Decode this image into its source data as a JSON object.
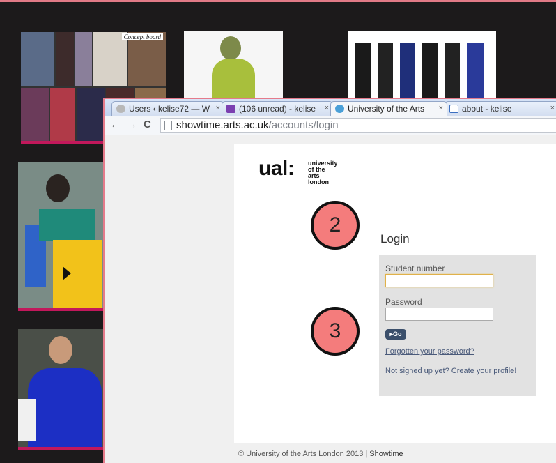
{
  "gallery": {
    "concept_label": "Concept board"
  },
  "browser": {
    "tabs": [
      {
        "label": "Users ‹ kelise72 — W",
        "icon": "wordpress-icon",
        "active": false
      },
      {
        "label": "(106 unread) - kelise",
        "icon": "mail-icon",
        "active": false
      },
      {
        "label": "University of the Arts",
        "icon": "globe-icon",
        "active": true
      },
      {
        "label": "about - kelise",
        "icon": "page-icon",
        "active": false
      }
    ],
    "tab_close": "×",
    "url_host": "showtime.arts.ac.uk",
    "url_path": "/accounts/login"
  },
  "page": {
    "logo_word": "ual:",
    "logo_sub": "university\nof the arts\nlondon",
    "login_title": "Login",
    "student_number_label": "Student number",
    "student_number_value": "",
    "password_label": "Password",
    "password_value": "",
    "go_label": "Go",
    "forgot_link": "Forgotten your password?",
    "signup_link": "Not signed up yet? Create your profile!",
    "footer_text": "© University of the Arts London 2013 | ",
    "footer_link": "Showtime"
  },
  "annotations": {
    "step_2": "2",
    "step_3": "3"
  },
  "colors": {
    "accent_pink": "#c2185b",
    "step_circle": "#f47c7c",
    "browser_frame": "#e57b8b"
  }
}
